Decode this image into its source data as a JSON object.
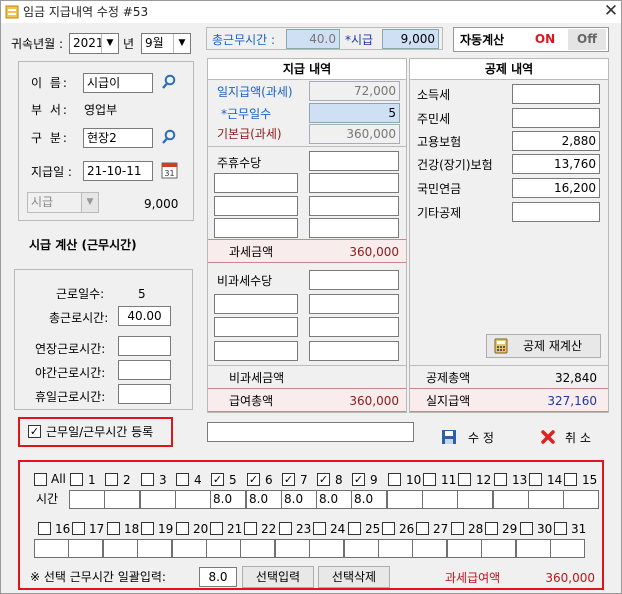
{
  "window": {
    "title": "임금 지급내역 수정 #53"
  },
  "header": {
    "year_month_label": "귀속년월 :",
    "year": "2021",
    "year_unit": "년",
    "month": "9월",
    "total_hours_label": "총근무시간 :",
    "total_hours_value": "40.0",
    "hourly_label": "*시급",
    "hourly_value": "9,000",
    "auto_calc_label": "자동계산",
    "on_label": "ON",
    "off_label": "Off"
  },
  "employee": {
    "name_label": "이  름:",
    "name_value": "시급이",
    "dept_label": "부  서:",
    "dept_value": "영업부",
    "type_label": "구  분:",
    "type_value": "현장2",
    "pay_date_label": "지급일 :",
    "pay_date_value": "21-10-11",
    "pay_type_value": "시급",
    "pay_rate_value": "9,000"
  },
  "hourly_calc": {
    "title": "시급 계산 (근무시간)",
    "work_days_label": "근로일수:",
    "work_days_value": "5",
    "total_work_label": "총근로시간:",
    "total_work_value": "40.00",
    "overtime_label": "연장근로시간:",
    "night_label": "야간근로시간:",
    "holiday_label": "휴일근로시간:",
    "register_label": "근무일/근무시간 등록",
    "register_checked": true
  },
  "payment": {
    "title": "지급 내역",
    "daily_pay_label": "일지급액(과세)",
    "daily_pay_value": "72,000",
    "work_days_label": "*근무일수",
    "work_days_value": "5",
    "base_pay_label": "기본급(과세)",
    "base_pay_value": "360,000",
    "weekly_allowance_label": "주휴수당",
    "taxable_total_label": "과세금액",
    "taxable_total_value": "360,000",
    "nontax_allowance_label": "비과세수당",
    "nontax_total_label": "비과세금액",
    "nontax_total_value": "",
    "gross_label": "급여총액",
    "gross_value": "360,000"
  },
  "deduction": {
    "title": "공제 내역",
    "items": [
      {
        "label": "소득세",
        "value": ""
      },
      {
        "label": "주민세",
        "value": ""
      },
      {
        "label": "고용보험",
        "value": "2,880"
      },
      {
        "label": "건강(장기)보험",
        "value": "13,760"
      },
      {
        "label": "국민연금",
        "value": "16,200"
      },
      {
        "label": "기타공제",
        "value": ""
      }
    ],
    "recalc_button": "공제 재계산",
    "total_label": "공제총액",
    "total_value": "32,840",
    "net_label": "실지급액",
    "net_value": "327,160"
  },
  "actions": {
    "save_label": "수 정",
    "cancel_label": "취 소"
  },
  "calendar": {
    "all_label": "All",
    "hours_label": "시간",
    "days_row1": [
      "1",
      "2",
      "3",
      "4",
      "5",
      "6",
      "7",
      "8",
      "9",
      "10",
      "11",
      "12",
      "13",
      "14",
      "15"
    ],
    "checked_row1": [
      false,
      false,
      false,
      false,
      true,
      true,
      true,
      true,
      true,
      false,
      false,
      false,
      false,
      false,
      false
    ],
    "hours_row1": [
      "",
      "",
      "",
      "",
      "8.0",
      "8.0",
      "8.0",
      "8.0",
      "8.0",
      "",
      "",
      "",
      "",
      "",
      ""
    ],
    "days_row2": [
      "16",
      "17",
      "18",
      "19",
      "20",
      "21",
      "22",
      "23",
      "24",
      "25",
      "26",
      "27",
      "28",
      "29",
      "30",
      "31"
    ],
    "checked_row2": [
      false,
      false,
      false,
      false,
      false,
      false,
      false,
      false,
      false,
      false,
      false,
      false,
      false,
      false,
      false,
      false
    ],
    "hours_row2": [
      "",
      "",
      "",
      "",
      "",
      "",
      "",
      "",
      "",
      "",
      "",
      "",
      "",
      "",
      "",
      ""
    ],
    "bulk_label": "※ 선택 근무시간 일괄입력:",
    "bulk_value": "8.0",
    "apply_button": "선택입력",
    "clear_button": "선택삭제",
    "taxable_label": "과세급여액",
    "taxable_value": "360,000"
  },
  "colors": {
    "highlight_red": "#e0141e",
    "on_red": "#e0141e",
    "blue_label": "#1a5fc8",
    "dark_red_label": "#8b1a1a",
    "net_blue": "#1a3aa0"
  }
}
